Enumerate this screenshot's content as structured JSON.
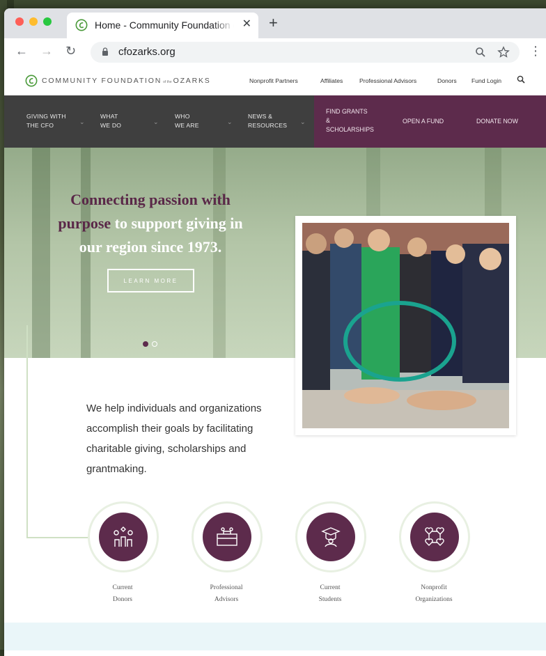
{
  "browser": {
    "tab_title": "Home - Community Foundation of the Ozarks",
    "tab_close": "✕",
    "new_tab": "+",
    "url": "cfozarks.org",
    "back": "←",
    "forward": "→",
    "reload": "↻",
    "menu": "⋮"
  },
  "logo": {
    "text_left": "COMMUNITY FOUNDATION",
    "text_small": "of the",
    "text_right": "OZARKS"
  },
  "utility_nav": [
    "Nonprofit Partners",
    "Affiliates",
    "Professional Advisors",
    "Donors",
    "Fund Login"
  ],
  "main_nav": {
    "items": [
      {
        "line1": "Giving with",
        "line2": "the CFO"
      },
      {
        "line1": "What",
        "line2": "we do"
      },
      {
        "line1": "Who",
        "line2": "we are"
      },
      {
        "line1": "News &",
        "line2": "Resources"
      }
    ],
    "cta": {
      "grants_l1": "Find Grants",
      "grants_l2": "&",
      "grants_l3": "Scholarships",
      "open_fund": "Open a Fund",
      "donate": "Donate Now"
    }
  },
  "hero": {
    "headline_strong_1": "Connecting passion with",
    "headline_strong_2": "purpose",
    "headline_rest_1": " to support giving in",
    "headline_rest_2": "our region since 1973.",
    "button": "LEARN MORE",
    "slides": 2,
    "active_slide": 1
  },
  "mission": "We help individuals and organizations accomplish their goals by facilitating charitable giving, scholarships and grantmaking.",
  "audiences": [
    {
      "line1": "Current",
      "line2": "Donors",
      "icon": "donors-icon"
    },
    {
      "line1": "Professional",
      "line2": "Advisors",
      "icon": "advisors-icon"
    },
    {
      "line1": "Current",
      "line2": "Students",
      "icon": "students-icon"
    },
    {
      "line1": "Nonprofit",
      "line2": "Organizations",
      "icon": "nonprofit-icon"
    }
  ],
  "colors": {
    "brand_purple": "#5d2b4c",
    "nav_dark": "#3f3f3f",
    "accent_green": "#cfe0c4"
  }
}
